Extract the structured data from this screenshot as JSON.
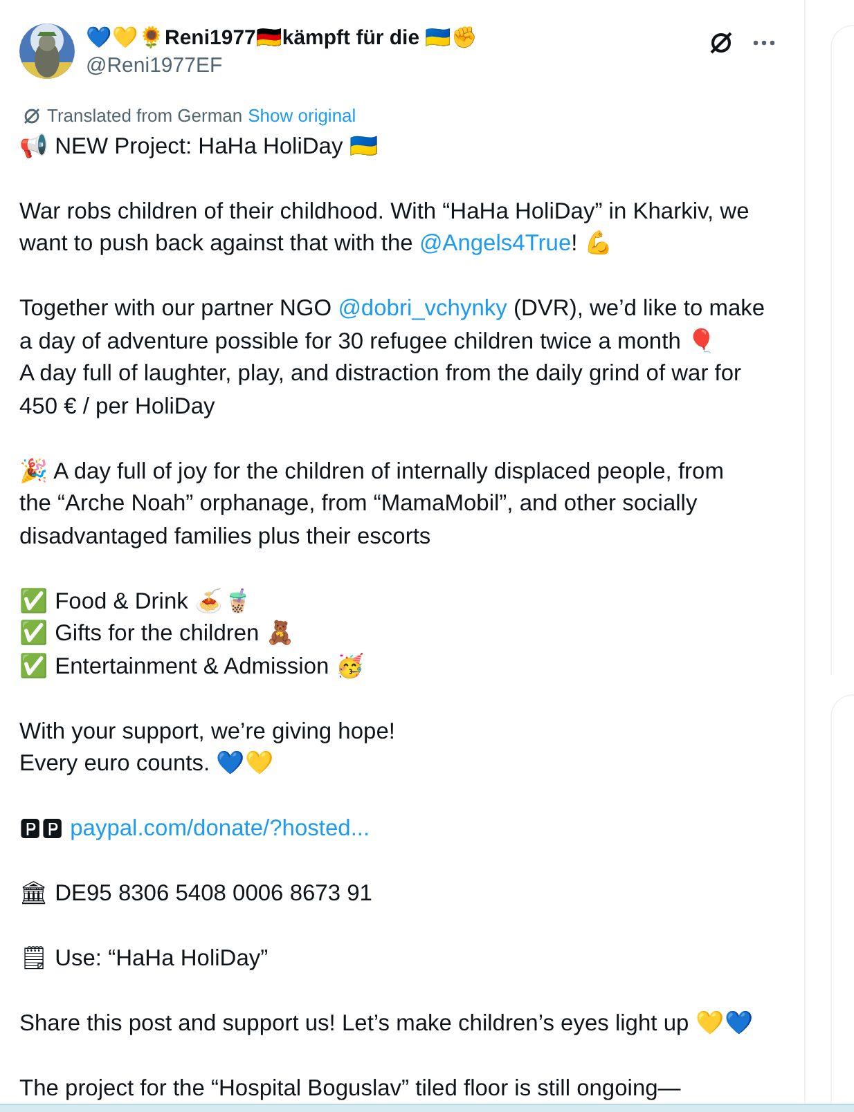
{
  "author": {
    "display_name": "💙💛🌻Reni1977🇩🇪kämpft für die 🇺🇦✊",
    "handle": "@Reni1977EF"
  },
  "translation": {
    "note": "Translated from German",
    "link": "Show original"
  },
  "paragraphs": [
    {
      "lines": [
        [
          {
            "kind": "text",
            "text": "📢 NEW Project: HaHa HoliDay 🇺🇦"
          }
        ]
      ]
    },
    {
      "lines": [
        [
          {
            "kind": "text",
            "text": "War robs children of their childhood. With “HaHa HoliDay” in Kharkiv, we"
          }
        ],
        [
          {
            "kind": "text",
            "text": "want to push back against that with the "
          },
          {
            "kind": "mention",
            "text": "@Angels4True"
          },
          {
            "kind": "text",
            "text": "! 💪"
          }
        ]
      ]
    },
    {
      "lines": [
        [
          {
            "kind": "text",
            "text": "Together with our partner NGO "
          },
          {
            "kind": "mention",
            "text": "@dobri_vchynky"
          },
          {
            "kind": "text",
            "text": " (DVR), we’d like to make"
          }
        ],
        [
          {
            "kind": "text",
            "text": "a day of adventure possible for 30 refugee children twice a month 🎈"
          }
        ],
        [
          {
            "kind": "text",
            "text": "A day full of laughter, play, and distraction from the daily grind of war for"
          }
        ],
        [
          {
            "kind": "text",
            "text": "450 € / per HoliDay"
          }
        ]
      ]
    },
    {
      "lines": [
        [
          {
            "kind": "text",
            "text": "🎉 A day full of joy for the children of internally displaced people, from"
          }
        ],
        [
          {
            "kind": "text",
            "text": "the “Arche Noah” orphanage, from “MamaMobil”, and other socially"
          }
        ],
        [
          {
            "kind": "text",
            "text": "disadvantaged families plus their escorts"
          }
        ]
      ]
    },
    {
      "lines": [
        [
          {
            "kind": "text",
            "text": "✅ Food & Drink 🍝🧋"
          }
        ],
        [
          {
            "kind": "text",
            "text": "✅ Gifts for the children 🧸"
          }
        ],
        [
          {
            "kind": "text",
            "text": "✅ Entertainment & Admission 🥳"
          }
        ]
      ]
    },
    {
      "lines": [
        [
          {
            "kind": "text",
            "text": "With your support, we’re giving hope!"
          }
        ],
        [
          {
            "kind": "text",
            "text": "Every euro counts. 💙💛"
          }
        ]
      ]
    },
    {
      "lines": [
        [
          {
            "kind": "text",
            "text": "🅿🅿 "
          },
          {
            "kind": "link",
            "text": "paypal.com/donate/?hosted..."
          }
        ]
      ]
    },
    {
      "lines": [
        [
          {
            "kind": "text",
            "text": "🏛 DE95 8306 5408 0006 8673 91"
          }
        ]
      ]
    },
    {
      "lines": [
        [
          {
            "kind": "text",
            "text": "🗒 Use: “HaHa HoliDay”"
          }
        ]
      ]
    },
    {
      "lines": [
        [
          {
            "kind": "text",
            "text": "Share this post and support us! Let’s make children’s eyes light up 💛💙"
          }
        ]
      ]
    },
    {
      "lines": [
        [
          {
            "kind": "text",
            "text": "The project for the “Hospital Boguslav” tiled floor is still ongoing—"
          }
        ]
      ]
    }
  ]
}
